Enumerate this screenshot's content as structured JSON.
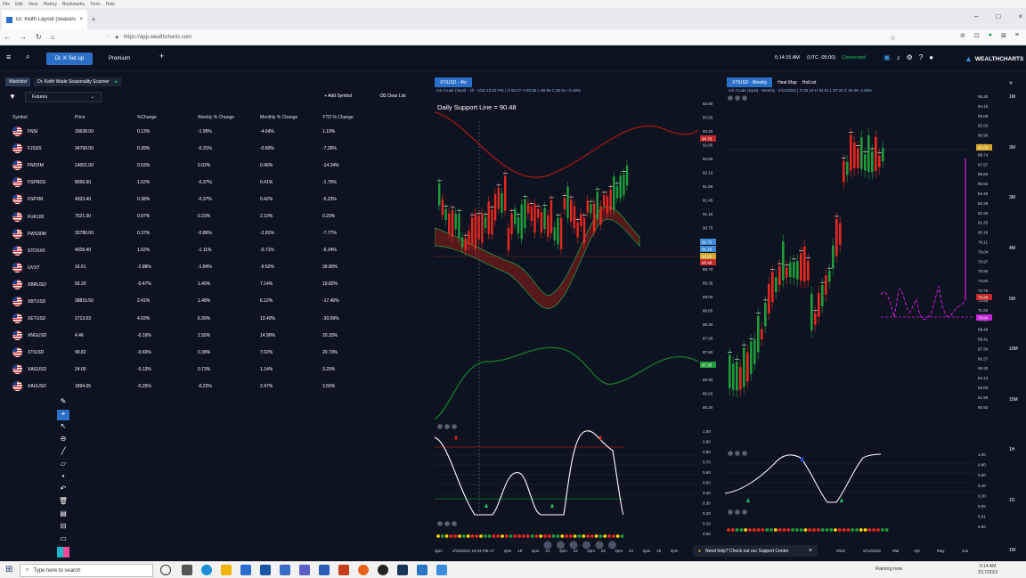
{
  "browser": {
    "menu": [
      "File",
      "Edit",
      "View",
      "History",
      "Bookmarks",
      "Tools",
      "Help"
    ],
    "tab_title": "Dr. Keith Layout (seasonal) - We",
    "url": "https://app.wealthcharts.com"
  },
  "header": {
    "tabs": [
      "Dr. K Set up",
      "Premium"
    ],
    "add": "+",
    "time": "6:14:15 AM",
    "timezone": "(UTC -05:00)",
    "connection": "Connected",
    "logo": "WEALTHCHARTS"
  },
  "watchlist": {
    "tabs": [
      "Watchlist",
      "Dr. Keith Wade Seasonality Scanner"
    ],
    "filter_value": "Futures",
    "add_symbol": "Add Symbol",
    "clear_list": "Clear List",
    "columns": [
      "Symbol",
      "Price",
      "%Change",
      "Weekly % Change",
      "Monthly % Change",
      "YTD % Change"
    ],
    "rows": [
      {
        "symbol": "FNSI",
        "price": "33638.00",
        "chg": "0.13%",
        "wk": "-1.95%",
        "mo": "-4.64%",
        "ytd": "1.19%"
      },
      {
        "symbol": "FJSSS",
        "price": "34799.00",
        "chg": "0.39%",
        "wk": "-0.31%",
        "mo": "-0.60%",
        "ytd": "-7.26%"
      },
      {
        "symbol": "FNDXM",
        "price": "14001.00",
        "chg": "0.53%",
        "wk": "0.02%",
        "mo": "0.46%",
        "ytd": "-14.34%"
      },
      {
        "symbol": "FSPNDS",
        "price": "8556.90",
        "chg": "1.52%",
        "wk": "-0.37%",
        "mo": "0.41%",
        "ytd": "-1.70%"
      },
      {
        "symbol": "FSPXM",
        "price": "4333.40",
        "chg": "0.38%",
        "wk": "-0.37%",
        "mo": "0.42%",
        "ytd": "-5.23%"
      },
      {
        "symbol": "FUK100",
        "price": "7521.00",
        "chg": "0.97%",
        "wk": "0.23%",
        "mo": "2.10%",
        "ytd": "0.29%"
      },
      {
        "symbol": "FWS30M",
        "price": "33780.00",
        "chg": "0.37%",
        "wk": "-0.86%",
        "mo": "-2.81%",
        "ytd": "-7.77%"
      },
      {
        "symbol": "STOXX5",
        "price": "4028.40",
        "chg": "1.02%",
        "wk": "-1.11%",
        "mo": "-0.71%",
        "ytd": "-6.24%"
      },
      {
        "symbol": "UVXY",
        "price": "16.61",
        "chg": "-2.88%",
        "wk": "-1.84%",
        "mo": "-9.62%",
        "ytd": "39.80%"
      },
      {
        "symbol": "XBRUSD",
        "price": "93.20",
        "chg": "-0.47%",
        "wk": "1.40%",
        "mo": "7.14%",
        "ytd": "19.82%"
      },
      {
        "symbol": "XBTUSD",
        "price": "38815.50",
        "chg": "2.41%",
        "wk": "1.48%",
        "mo": "6.12%",
        "ytd": "-17.46%"
      },
      {
        "symbol": "XETUSD",
        "price": "2713.03",
        "chg": "4.03%",
        "wk": "6.39%",
        "mo": "13.40%",
        "ytd": "-30.09%"
      },
      {
        "symbol": "XNGUSD",
        "price": "4.46",
        "chg": "-0.16%",
        "wk": "1.55%",
        "mo": "14.90%",
        "ytd": "20.33%"
      },
      {
        "symbol": "XTIUSD",
        "price": "90.82",
        "chg": "-0.60%",
        "wk": "0.38%",
        "mo": "7.02%",
        "ytd": "20.73%"
      },
      {
        "symbol": "XAGUSD",
        "price": "24.00",
        "chg": "-0.13%",
        "wk": "0.73%",
        "mo": "1.14%",
        "ytd": "3.29%"
      },
      {
        "symbol": "XAUUSD",
        "price": "1894.05",
        "chg": "-0.25%",
        "wk": "-0.22%",
        "mo": "2.47%",
        "ytd": "3.55%"
      }
    ]
  },
  "chart_left": {
    "tab": "XTIUSD - 4hr",
    "desc": "US Crude (Spot) - 4h - 2/15 10:03 PM | O 93.07 H 93.55 L 89.96 C 90.51 +0.48%",
    "annotation": "Daily Support Line = 90.48",
    "price_axis": [
      "93.90",
      "93.55",
      "93.20",
      "92.85",
      "92.50",
      "92.15",
      "91.80",
      "91.45",
      "91.10",
      "90.75",
      "90.40",
      "90.05",
      "89.70",
      "89.35",
      "89.00",
      "88.65",
      "88.30",
      "87.95",
      "87.60",
      "87.25",
      "86.90",
      "86.55",
      "86.20"
    ],
    "badges": [
      {
        "text": "94.79",
        "color": "#c0282d"
      },
      {
        "text": "91.72",
        "color": "#3b8bd6"
      },
      {
        "text": "91.18",
        "color": "#3b8bd6"
      },
      {
        "text": "90.90",
        "color": "#d4a72c"
      },
      {
        "text": "90.48",
        "color": "#c0282d"
      },
      {
        "text": "87.35",
        "color": "#1f9d3a"
      }
    ],
    "osc_axis": [
      "1.00",
      "0.90",
      "0.80",
      "0.70",
      "0.60",
      "0.50",
      "0.40",
      "0.30",
      "0.20",
      "0.10",
      "0.00"
    ],
    "time_axis": [
      "2/15/2022 10:03 PM",
      "17",
      "2pm",
      "18",
      "2pm",
      "21",
      "2pm",
      "22",
      "2pm",
      "23",
      "2pm",
      "24",
      "2pm",
      "25",
      "2pm"
    ],
    "time_prefix": "2pm"
  },
  "chart_right": {
    "tabs": [
      "XTIUSD - Weekly",
      "Heat Map",
      "HotList"
    ],
    "desc": "US Crude (Spot) - Weekly - 2/14/2022 | O 93.10 H 94.01 L 87.26 C 90.48 -2.80%",
    "price_axis": [
      "95.30",
      "94.16",
      "93.08",
      "92.02",
      "90.95",
      "89.81",
      "88.74",
      "87.67",
      "86.60",
      "85.53",
      "84.46",
      "83.39",
      "82.32",
      "81.25",
      "80.18",
      "79.11",
      "78.04",
      "76.97",
      "75.90",
      "74.83",
      "73.76",
      "72.69",
      "71.62",
      "70.55",
      "69.48",
      "68.41",
      "67.34",
      "66.27",
      "65.20",
      "64.13",
      "63.06",
      "61.99",
      "60.92"
    ],
    "badges": [
      {
        "text": "91.06",
        "color": "#d4a72c"
      },
      {
        "text": "75.88",
        "color": "#c0282d"
      },
      {
        "text": "73.64",
        "color": "#c026d3"
      }
    ],
    "osc_axis": [
      "1.00",
      "0.80",
      "0.60",
      "0.40",
      "0.20",
      "0.05",
      "0.01",
      "0.00"
    ],
    "time_axis": [
      "2022",
      "2/14/2022",
      "Mar",
      "Apr",
      "May",
      "Jun"
    ]
  },
  "timeframes": [
    "1M",
    "3M",
    "3M",
    "4M",
    "5M",
    "10M",
    "15M",
    "1H",
    "1D",
    "1W"
  ],
  "help_text": "Need help? Check out our Support Center",
  "taskbar": {
    "search": "Type here to search",
    "status": "Raining now",
    "time": "6:14 AM",
    "date": "2/17/2022"
  },
  "colors": {
    "accent": "#2b6fc9",
    "bull": "#1f9d3a",
    "bear": "#e8281e",
    "osc": "#ffffff",
    "magenta": "#e11de8"
  }
}
